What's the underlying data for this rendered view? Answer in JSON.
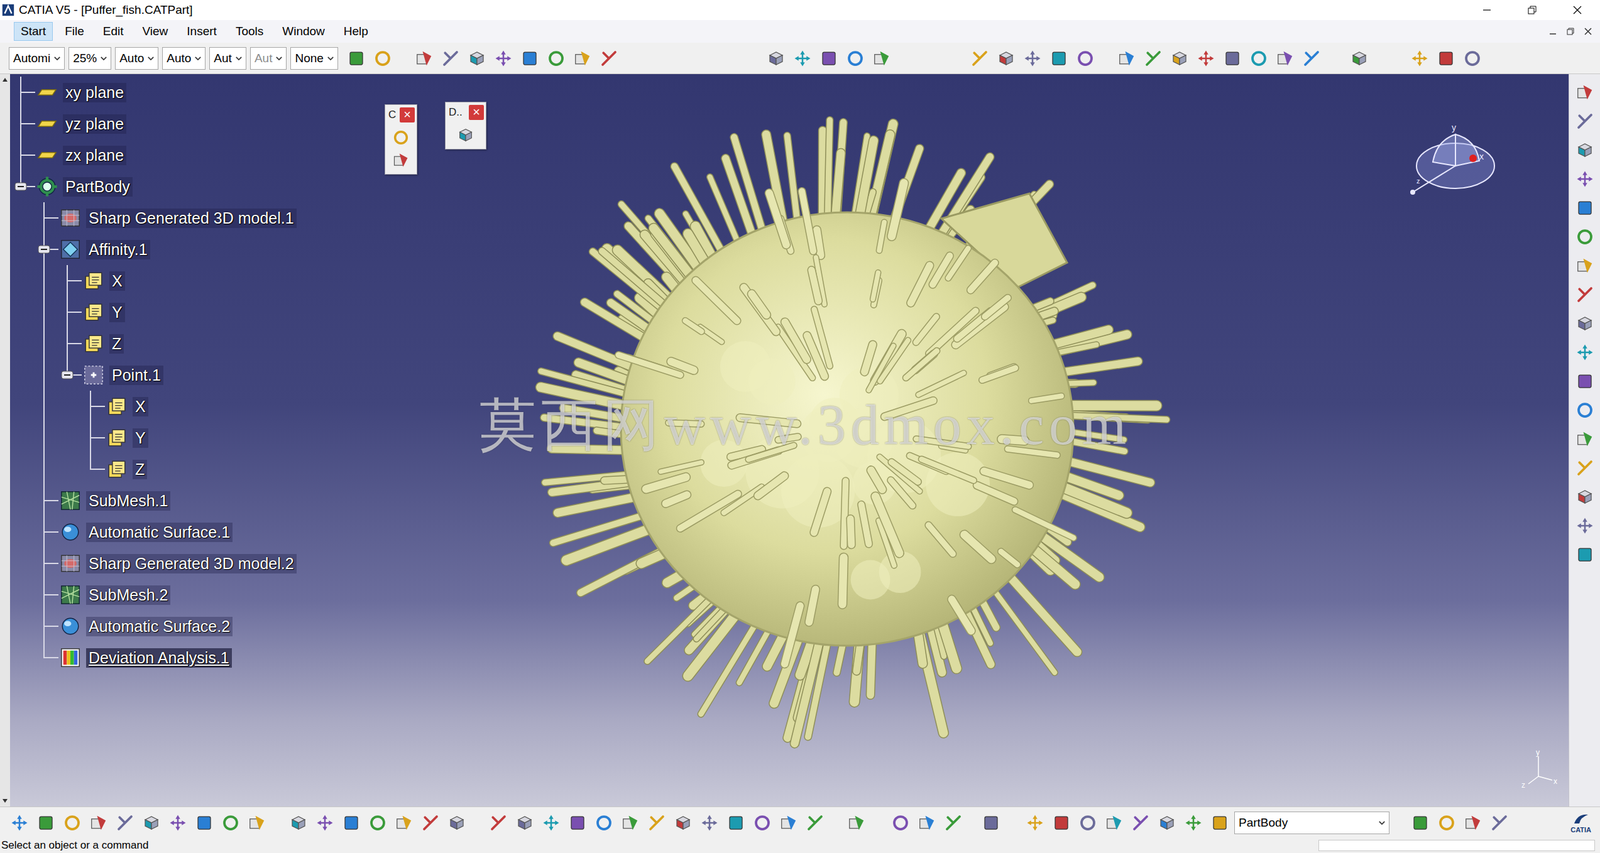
{
  "window": {
    "title": "CATIA V5 - [Puffer_fish.CATPart]"
  },
  "menu": [
    {
      "label": "Start",
      "selected": true
    },
    {
      "label": "File",
      "selected": false
    },
    {
      "label": "Edit",
      "selected": false
    },
    {
      "label": "View",
      "selected": false
    },
    {
      "label": "Insert",
      "selected": false
    },
    {
      "label": "Tools",
      "selected": false
    },
    {
      "label": "Window",
      "selected": false
    },
    {
      "label": "Help",
      "selected": false
    }
  ],
  "toolbar": {
    "dropdowns": [
      {
        "value": "Automi",
        "disabled": false
      },
      {
        "value": "25%",
        "disabled": false
      },
      {
        "value": "Auto",
        "disabled": false
      },
      {
        "value": "Auto",
        "disabled": false
      },
      {
        "value": "Aut",
        "disabled": false
      },
      {
        "value": "Aut",
        "disabled": true
      },
      {
        "value": "None",
        "disabled": false
      }
    ]
  },
  "tree": [
    {
      "label": "xy plane",
      "level": 0,
      "kind": "plane",
      "expandable": false,
      "expanded": false,
      "selected": false
    },
    {
      "label": "yz plane",
      "level": 0,
      "kind": "plane",
      "expandable": false,
      "expanded": false,
      "selected": false
    },
    {
      "label": "zx plane",
      "level": 0,
      "kind": "plane",
      "expandable": false,
      "expanded": false,
      "selected": false
    },
    {
      "label": "PartBody",
      "level": 0,
      "kind": "body",
      "expandable": true,
      "expanded": true,
      "selected": false
    },
    {
      "label": "Sharp Generated 3D model.1",
      "level": 1,
      "kind": "model",
      "expandable": false,
      "expanded": false,
      "selected": false
    },
    {
      "label": "Affinity.1",
      "level": 1,
      "kind": "affinity",
      "expandable": true,
      "expanded": true,
      "selected": false
    },
    {
      "label": "X",
      "level": 2,
      "kind": "param",
      "expandable": false,
      "expanded": false,
      "selected": false
    },
    {
      "label": "Y",
      "level": 2,
      "kind": "param",
      "expandable": false,
      "expanded": false,
      "selected": false
    },
    {
      "label": "Z",
      "level": 2,
      "kind": "param",
      "expandable": false,
      "expanded": false,
      "selected": false
    },
    {
      "label": "Point.1",
      "level": 2,
      "kind": "point",
      "expandable": true,
      "expanded": true,
      "selected": false
    },
    {
      "label": "X",
      "level": 3,
      "kind": "param",
      "expandable": false,
      "expanded": false,
      "selected": false
    },
    {
      "label": "Y",
      "level": 3,
      "kind": "param",
      "expandable": false,
      "expanded": false,
      "selected": false
    },
    {
      "label": "Z",
      "level": 3,
      "kind": "param",
      "expandable": false,
      "expanded": false,
      "selected": false
    },
    {
      "label": "SubMesh.1",
      "level": 1,
      "kind": "submesh",
      "expandable": false,
      "expanded": false,
      "selected": false
    },
    {
      "label": "Automatic Surface.1",
      "level": 1,
      "kind": "surface",
      "expandable": false,
      "expanded": false,
      "selected": false
    },
    {
      "label": "Sharp Generated 3D model.2",
      "level": 1,
      "kind": "model",
      "expandable": false,
      "expanded": false,
      "selected": false
    },
    {
      "label": "SubMesh.2",
      "level": 1,
      "kind": "submesh",
      "expandable": false,
      "expanded": false,
      "selected": false
    },
    {
      "label": "Automatic Surface.2",
      "level": 1,
      "kind": "surface",
      "expandable": false,
      "expanded": false,
      "selected": false
    },
    {
      "label": "Deviation Analysis.1",
      "level": 1,
      "kind": "analysis",
      "expandable": false,
      "expanded": false,
      "selected": true
    }
  ],
  "floating_toolbars": [
    {
      "title": "C",
      "close": "×"
    },
    {
      "title": "D..",
      "close": "×"
    }
  ],
  "watermark": "莫西网www.3dmox.com",
  "compass": {
    "labels": [
      "y",
      "x",
      "z"
    ]
  },
  "axis": {
    "labels": [
      "y",
      "x",
      "z"
    ]
  },
  "bottom_toolbar": {
    "dropdown": "PartBody",
    "logo": "CATIA"
  },
  "status_bar": "Select an object or a command"
}
